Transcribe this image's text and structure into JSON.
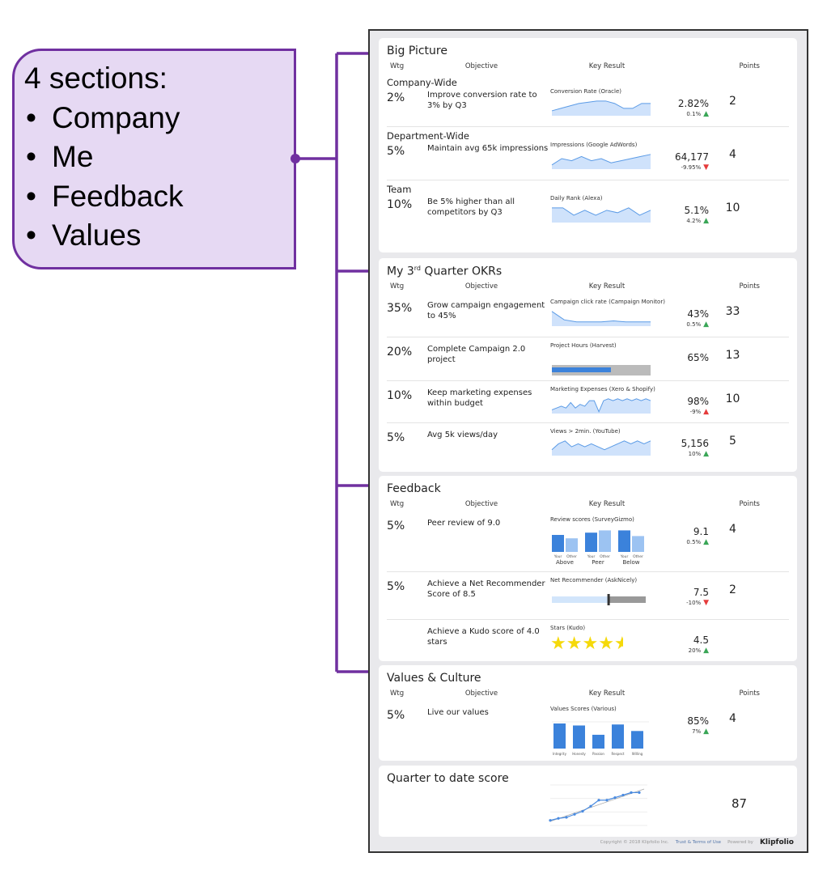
{
  "callout": {
    "heading": "4 sections:",
    "bullets": [
      "Company",
      "Me",
      "Feedback",
      "Values"
    ],
    "border_color": "#7030a0",
    "fill_color": "#e6d9f3"
  },
  "colors": {
    "up": "#3aa657",
    "down": "#e53b3b",
    "bar": "#3b82db",
    "bar_light": "#9cc3f2",
    "spark_line": "#5b9be6",
    "spark_fill": "#cfe2fb",
    "star": "#f5d90a"
  },
  "headers": {
    "wtg": "Wtg",
    "objective": "Objective",
    "key_result": "Key Result",
    "points": "Points"
  },
  "sections": [
    {
      "title": "Big Picture",
      "rows": [
        {
          "group": "Company-Wide",
          "wtg": "2%",
          "objective": "Improve conversion rate to 3% by Q3",
          "kr_title": "Conversion Rate (Oracle)",
          "chart": "spark",
          "spark": [
            2,
            3,
            4,
            5,
            5.5,
            6,
            6,
            5,
            3,
            3,
            5,
            5
          ],
          "value": "2.82%",
          "delta": "0.1%",
          "dir": "up",
          "points": "2"
        },
        {
          "group": "Department-Wide",
          "wtg": "5%",
          "objective": "Maintain avg 65k impressions",
          "kr_title": "Impressions (Google AdWords)",
          "chart": "spark",
          "spark": [
            2,
            5,
            4,
            6,
            4,
            5,
            3,
            4,
            5,
            6,
            7
          ],
          "value": "64,177",
          "delta": "-9.95%",
          "dir": "down",
          "points": "4"
        },
        {
          "group": "Team",
          "wtg": "10%",
          "objective": "Be 5% higher than all competitors by Q3",
          "kr_title": "Daily Rank (Alexa)",
          "chart": "spark",
          "spark": [
            6,
            6,
            3,
            5,
            3,
            5,
            4,
            6,
            3,
            5
          ],
          "value": "5.1%",
          "delta": "4.2%",
          "dir": "up",
          "points": "10"
        }
      ]
    },
    {
      "title": "My 3",
      "title_sup": "rd",
      "title_rest": " Quarter OKRs",
      "rows": [
        {
          "wtg": "35%",
          "objective": "Grow campaign engagement to 45%",
          "kr_title": "Campaign click rate (Campaign Monitor)",
          "chart": "spark",
          "spark": [
            7,
            3,
            2,
            2,
            2,
            2.5,
            2,
            2,
            2
          ],
          "value": "43%",
          "delta": "0.5%",
          "dir": "up",
          "points": "33"
        },
        {
          "wtg": "20%",
          "objective": "Complete Campaign 2.0 project",
          "kr_title": "Project Hours (Harvest)",
          "chart": "progress",
          "progress": 65,
          "value": "65%",
          "points": "13"
        },
        {
          "wtg": "10%",
          "objective": "Keep marketing expenses within budget",
          "kr_title": "Marketing Expenses (Xero & Shopify)",
          "chart": "spark",
          "spark": [
            2,
            3,
            4,
            3,
            6,
            3,
            5,
            4,
            7,
            7,
            1,
            7,
            8,
            7,
            8,
            7,
            8,
            7,
            8,
            7,
            8,
            7
          ],
          "value": "98%",
          "delta": "-9%",
          "dir": "up-red",
          "points": "10"
        },
        {
          "wtg": "5%",
          "objective": "Avg 5k views/day",
          "kr_title": "Views > 2min. (YouTube)",
          "chart": "spark",
          "spark": [
            2,
            4,
            5,
            3,
            4,
            3,
            4,
            3,
            2,
            3,
            4,
            5,
            4,
            5,
            4,
            5
          ],
          "value": "5,156",
          "delta": "10%",
          "dir": "up",
          "points": "5"
        }
      ]
    },
    {
      "title": "Feedback",
      "rows": [
        {
          "wtg": "5%",
          "objective": "Peer review of 9.0",
          "kr_title": "Review scores (SurveyGizmo)",
          "chart": "groupbars",
          "groups": [
            {
              "label": "Above",
              "your": 7.5,
              "other": 6
            },
            {
              "label": "Peer",
              "your": 8.5,
              "other": 9.5
            },
            {
              "label": "Below",
              "your": 9.5,
              "other": 7
            }
          ],
          "bar_labels": {
            "your": "Your",
            "other": "Other"
          },
          "value": "9.1",
          "delta": "0.5%",
          "dir": "up",
          "points": "4"
        },
        {
          "wtg": "5%",
          "objective": "Achieve a Net Recommender Score of 8.5",
          "kr_title": "Net Recommender (AskNicely)",
          "chart": "bullet",
          "bullet_fill": 0.6,
          "value": "7.5",
          "delta": "-10%",
          "dir": "down",
          "points": "2"
        },
        {
          "wtg": "",
          "objective": "Achieve a Kudo score of 4.0 stars",
          "kr_title": "Stars (Kudo)",
          "chart": "stars",
          "stars": 4.5,
          "stars_max": 5,
          "value": "4.5",
          "delta": "20%",
          "dir": "up",
          "points": ""
        }
      ]
    },
    {
      "title": "Values & Culture",
      "rows": [
        {
          "wtg": "5%",
          "objective": "Live our values",
          "kr_title": "Values Scores (Various)",
          "chart": "bars",
          "bars": [
            {
              "label": "Integrity",
              "value": 100
            },
            {
              "label": "Honesty",
              "value": 92
            },
            {
              "label": "Passion",
              "value": 55
            },
            {
              "label": "Respect",
              "value": 96
            },
            {
              "label": "Willing",
              "value": 70
            }
          ],
          "value": "85%",
          "delta": "7%",
          "dir": "up",
          "points": "4"
        }
      ]
    }
  ],
  "quarter": {
    "title": "Quarter to date score",
    "score": "87",
    "series": [
      10,
      14,
      16,
      22,
      28,
      38,
      50,
      50,
      55,
      60,
      65,
      65
    ],
    "trend": [
      8,
      72
    ],
    "ylim": [
      0,
      80
    ]
  },
  "footer": {
    "copyright": "Copyright © 2018 Klipfolio Inc.",
    "terms": "Trust & Terms of Use",
    "powered": "Powered by",
    "logo": "Klipfolio"
  }
}
